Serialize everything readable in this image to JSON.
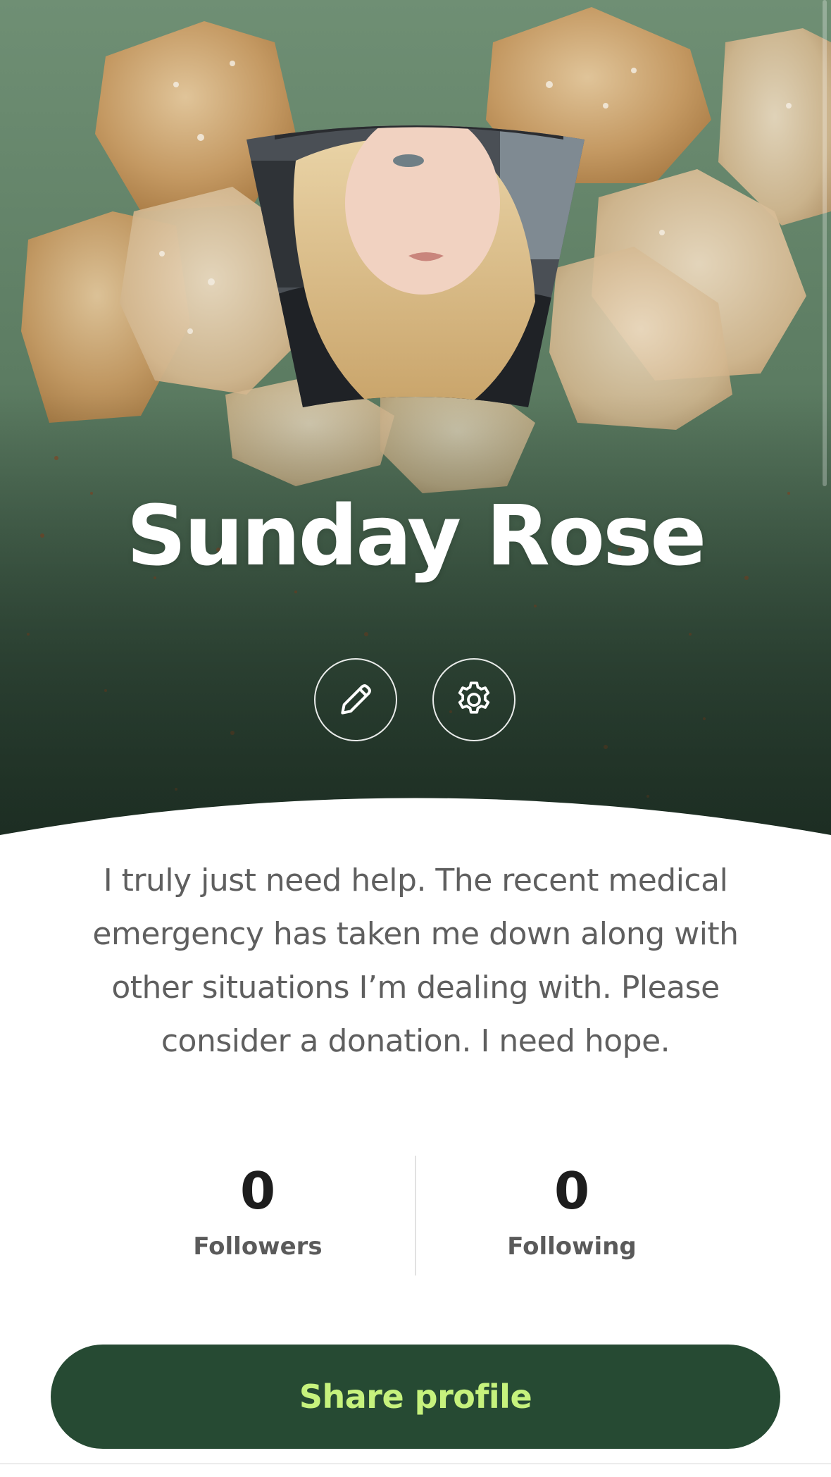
{
  "profile": {
    "name": "Sunday Rose",
    "bio": "I truly just need help.  The recent medical emergency has taken me down along with other situations I’m dealing with.  Please consider a donation.  I need hope."
  },
  "actions": {
    "edit_icon": "pencil-icon",
    "settings_icon": "gear-icon"
  },
  "stats": {
    "followers": {
      "value": "0",
      "label": "Followers"
    },
    "following": {
      "value": "0",
      "label": "Following"
    }
  },
  "share": {
    "label": "Share profile"
  },
  "colors": {
    "hero_green": "#5c7c62",
    "button_bg": "#264a33",
    "button_text": "#c6f27d",
    "bio_text": "#5f5f5f"
  }
}
